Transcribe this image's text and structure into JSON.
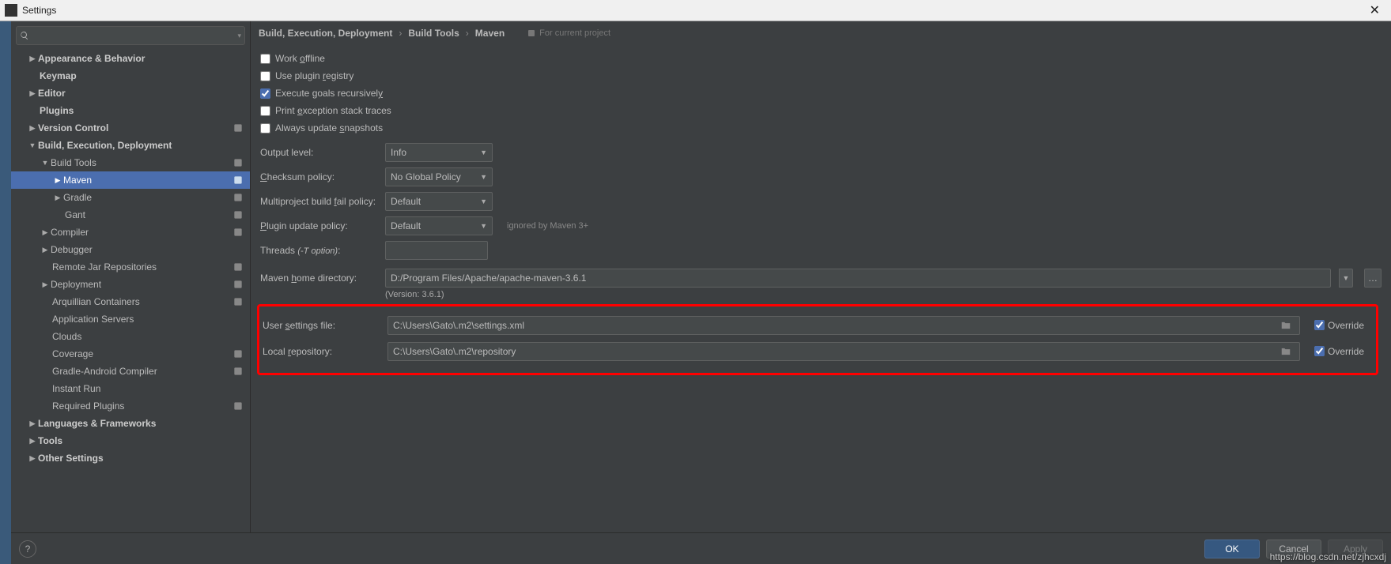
{
  "window": {
    "title": "Settings"
  },
  "search": {
    "placeholder": ""
  },
  "tree": {
    "appearance": "Appearance & Behavior",
    "keymap": "Keymap",
    "editor": "Editor",
    "plugins": "Plugins",
    "vcs": "Version Control",
    "bed": "Build, Execution, Deployment",
    "build_tools": "Build Tools",
    "maven": "Maven",
    "gradle": "Gradle",
    "gant": "Gant",
    "compiler": "Compiler",
    "debugger": "Debugger",
    "remote_jar": "Remote Jar Repositories",
    "deployment": "Deployment",
    "arquillian": "Arquillian Containers",
    "app_servers": "Application Servers",
    "clouds": "Clouds",
    "coverage": "Coverage",
    "gradle_android": "Gradle-Android Compiler",
    "instant_run": "Instant Run",
    "required_plugins": "Required Plugins",
    "languages": "Languages & Frameworks",
    "tools": "Tools",
    "other": "Other Settings"
  },
  "breadcrumb": {
    "a": "Build, Execution, Deployment",
    "b": "Build Tools",
    "c": "Maven",
    "hint": "For current project"
  },
  "checks": {
    "work_offline": "Work offline",
    "use_plugin_registry": "Use plugin registry",
    "execute_goals": "Execute goals recursively",
    "print_exception": "Print exception stack traces",
    "always_update": "Always update snapshots"
  },
  "fields": {
    "output_level": {
      "label": "Output level:",
      "value": "Info"
    },
    "checksum_policy": {
      "label": "Checksum policy:",
      "value": "No Global Policy"
    },
    "multiproject": {
      "label": "Multiproject build fail policy:",
      "value": "Default"
    },
    "plugin_update": {
      "label": "Plugin update policy:",
      "value": "Default",
      "hint": "ignored by Maven 3+"
    },
    "threads": {
      "label": "Threads (-T option):",
      "value": ""
    },
    "maven_home": {
      "label": "Maven home directory:",
      "value": "D:/Program Files/Apache/apache-maven-3.6.1"
    },
    "version": "(Version: 3.6.1)",
    "user_settings": {
      "label": "User settings file:",
      "value": "C:\\Users\\Gato\\.m2\\settings.xml"
    },
    "local_repo": {
      "label": "Local repository:",
      "value": "C:\\Users\\Gato\\.m2\\repository"
    },
    "override": "Override"
  },
  "buttons": {
    "ok": "OK",
    "cancel": "Cancel",
    "apply": "Apply"
  },
  "watermark": "https://blog.csdn.net/zjhcxdj"
}
